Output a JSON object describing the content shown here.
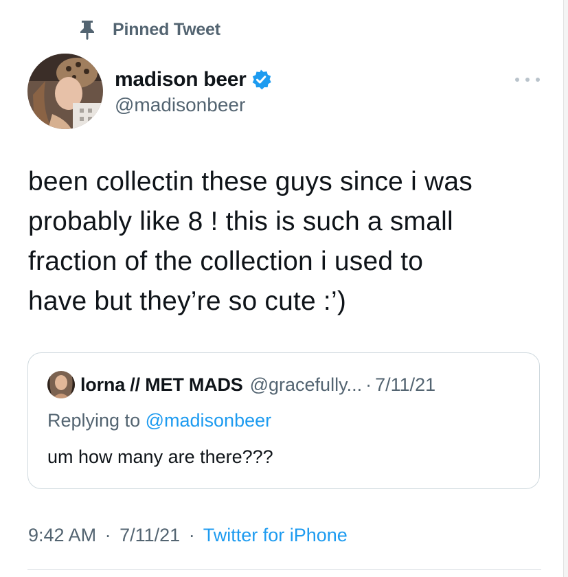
{
  "pinned": {
    "label": "Pinned Tweet",
    "icon": "pin-icon"
  },
  "author": {
    "display_name": "madison beer",
    "handle": "@madisonbeer",
    "verified_icon": "verified-badge-icon",
    "verified_color": "#1d9bf0"
  },
  "tweet": {
    "text": "been collectin these guys since i was\nprobably like 8 ! this is such a small\nfraction of the collection i used to\nhave but they’re so cute :’)"
  },
  "quote": {
    "display_name": "lorna // MET MADS",
    "handle": "@gracefully...",
    "separator": "·",
    "date": "7/11/21",
    "replying_prefix": "Replying to",
    "replying_to": "@madisonbeer",
    "text": "um how many are there???"
  },
  "meta": {
    "time": "9:42 AM",
    "date": "7/11/21",
    "separator": "·",
    "source": "Twitter for iPhone"
  },
  "colors": {
    "primary_text": "#0f1419",
    "secondary_text": "#536471",
    "link": "#1d9bf0",
    "border": "#cfd9de"
  }
}
